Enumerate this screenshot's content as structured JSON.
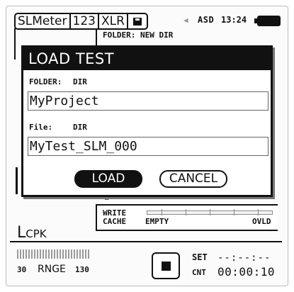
{
  "statusbar": {
    "tabs": [
      "SLMeter",
      "123",
      "XLR"
    ],
    "save_icon": "save-icon",
    "speaker_icon": "speaker-icon",
    "asd": "ASD",
    "time": "13:24",
    "battery_icon": "battery-icon"
  },
  "background": {
    "folder_text": "FOLDER: NEW DIR",
    "cache_write": "WRITE",
    "cache_cache": "CACHE",
    "cache_empty": "EMPTY",
    "cache_full": "OVLD",
    "measure": "L",
    "measure_sub": "CPK",
    "range_min": "30",
    "range_label": "RNGE",
    "range_max": "130",
    "set_label": "SET",
    "set_value": "--:--:--",
    "cnt_label": "CNT",
    "cnt_value": "00:00:10",
    "stop_icon": "stop-icon"
  },
  "dialog": {
    "title": "LOAD TEST",
    "folder_label": "FOLDER:",
    "folder_sub": "DIR",
    "folder_value": "MyProject",
    "file_label": "File:",
    "file_sub": "DIR",
    "file_value": "MyTest_SLM_000",
    "load_button": "LOAD",
    "cancel_button": "CANCEL"
  },
  "colors": {
    "ink": "#111111",
    "background": "#ffffff"
  }
}
